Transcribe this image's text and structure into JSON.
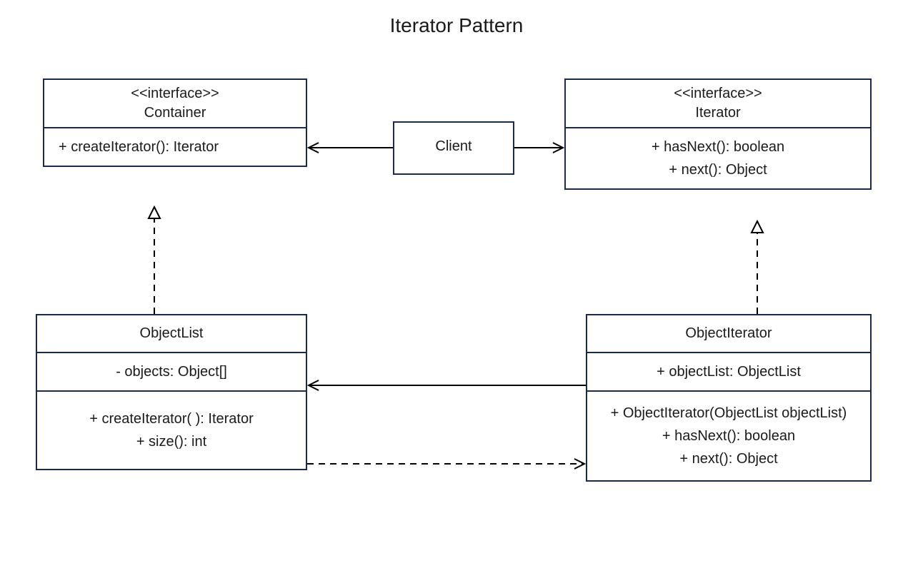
{
  "title": "Iterator Pattern",
  "container": {
    "stereotype": "<<interface>>",
    "name": "Container",
    "methods": [
      "+  createIterator(): Iterator"
    ]
  },
  "iterator": {
    "stereotype": "<<interface>>",
    "name": "Iterator",
    "methods": [
      "+   hasNext(): boolean",
      "+   next(): Object"
    ]
  },
  "client": {
    "name": "Client"
  },
  "objectList": {
    "name": "ObjectList",
    "attributes": [
      "-  objects: Object[]"
    ],
    "methods": [
      "+   createIterator( ): Iterator",
      "+   size(): int"
    ]
  },
  "objectIterator": {
    "name": "ObjectIterator",
    "attributes": [
      "+   objectList: ObjectList"
    ],
    "methods": [
      "+   ObjectIterator(ObjectList objectList)",
      "+   hasNext(): boolean",
      "+   next(): Object"
    ]
  },
  "chart_data": {
    "type": "diagram",
    "subtype": "uml-class",
    "title": "Iterator Pattern",
    "nodes": [
      {
        "id": "Client",
        "kind": "class",
        "name": "Client"
      },
      {
        "id": "Container",
        "kind": "interface",
        "name": "Container",
        "methods": [
          "+ createIterator(): Iterator"
        ]
      },
      {
        "id": "Iterator",
        "kind": "interface",
        "name": "Iterator",
        "methods": [
          "+ hasNext(): boolean",
          "+ next(): Object"
        ]
      },
      {
        "id": "ObjectList",
        "kind": "class",
        "name": "ObjectList",
        "attributes": [
          "- objects: Object[]"
        ],
        "methods": [
          "+ createIterator(): Iterator",
          "+ size(): int"
        ]
      },
      {
        "id": "ObjectIterator",
        "kind": "class",
        "name": "ObjectIterator",
        "attributes": [
          "+ objectList: ObjectList"
        ],
        "methods": [
          "+ ObjectIterator(ObjectList objectList)",
          "+ hasNext(): boolean",
          "+ next(): Object"
        ]
      }
    ],
    "edges": [
      {
        "from": "Client",
        "to": "Container",
        "type": "association",
        "arrow": "open"
      },
      {
        "from": "Client",
        "to": "Iterator",
        "type": "association",
        "arrow": "open"
      },
      {
        "from": "ObjectList",
        "to": "Container",
        "type": "realization",
        "style": "dashed",
        "arrow": "hollow-triangle"
      },
      {
        "from": "ObjectIterator",
        "to": "Iterator",
        "type": "realization",
        "style": "dashed",
        "arrow": "hollow-triangle"
      },
      {
        "from": "ObjectIterator",
        "to": "ObjectList",
        "type": "association",
        "arrow": "open"
      },
      {
        "from": "ObjectList",
        "to": "ObjectIterator",
        "type": "dependency",
        "style": "dashed",
        "arrow": "open"
      }
    ]
  }
}
